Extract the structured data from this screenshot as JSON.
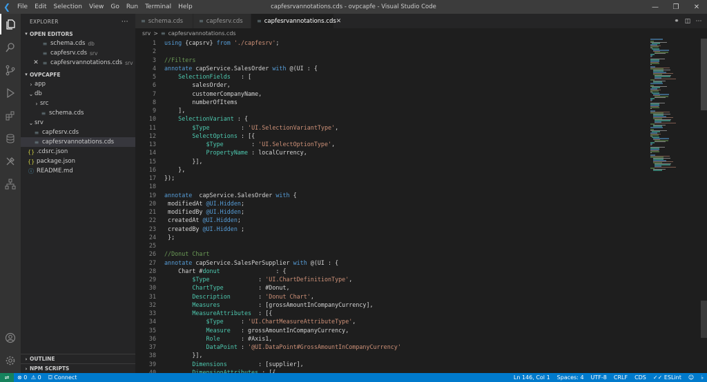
{
  "titlebar": {
    "menu": [
      "File",
      "Edit",
      "Selection",
      "View",
      "Go",
      "Run",
      "Terminal",
      "Help"
    ],
    "title": "capfesrvannotations.cds - ovpcapfe - Visual Studio Code"
  },
  "sidebar": {
    "header": "EXPLORER",
    "open_editors_label": "OPEN EDITORS",
    "open_editors": [
      {
        "name": "schema.cds",
        "dir": "db"
      },
      {
        "name": "capfesrv.cds",
        "dir": "srv"
      },
      {
        "name": "capfesrvannotations.cds",
        "dir": "srv"
      }
    ],
    "project_label": "OVPCAPFE",
    "tree": {
      "app": "app",
      "db": "db",
      "db_src": "src",
      "db_schema": "schema.cds",
      "srv": "srv",
      "srv_capfesrv": "capfesrv.cds",
      "srv_annotations": "capfesrvannotations.cds",
      "cdsrc": ".cdsrc.json",
      "package": "package.json",
      "readme": "README.md"
    },
    "outline_label": "OUTLINE",
    "npm_label": "NPM SCRIPTS"
  },
  "tabs": [
    {
      "label": "schema.cds"
    },
    {
      "label": "capfesrv.cds"
    },
    {
      "label": "capfesrvannotations.cds"
    }
  ],
  "breadcrumb": {
    "folder": "srv",
    "sep": ">",
    "file": "capfesrvannotations.cds"
  },
  "editor": {
    "colors": {
      "kw": "#569cd6",
      "str": "#ce9178",
      "comment": "#6a9955",
      "prop": "#4ec9b0",
      "text": "#d4d4d4"
    },
    "lines": [
      {
        "n": "1",
        "tokens": [
          [
            "kw",
            "using "
          ],
          [
            "t",
            "{capsrv} "
          ],
          [
            "kw",
            "from "
          ],
          [
            "str",
            "'./capfesrv'"
          ],
          [
            "t",
            ";"
          ]
        ]
      },
      {
        "n": "2",
        "tokens": []
      },
      {
        "n": "3",
        "tokens": [
          [
            "c",
            "//Filters"
          ]
        ]
      },
      {
        "n": "4",
        "tokens": [
          [
            "kw",
            "annotate "
          ],
          [
            "t",
            "capService.SalesOrder "
          ],
          [
            "kw",
            "with "
          ],
          [
            "t",
            "@(UI : {"
          ]
        ]
      },
      {
        "n": "5",
        "tokens": [
          [
            "t",
            "    "
          ],
          [
            "p",
            "SelectionFields "
          ],
          [
            "t",
            "  : ["
          ]
        ]
      },
      {
        "n": "6",
        "tokens": [
          [
            "t",
            "        salesOrder,"
          ]
        ]
      },
      {
        "n": "7",
        "tokens": [
          [
            "t",
            "        customerCompanyName,"
          ]
        ]
      },
      {
        "n": "8",
        "tokens": [
          [
            "t",
            "        numberOfItems"
          ]
        ]
      },
      {
        "n": "9",
        "tokens": [
          [
            "t",
            "    ],"
          ]
        ]
      },
      {
        "n": "10",
        "tokens": [
          [
            "t",
            "    "
          ],
          [
            "p",
            "SelectionVariant "
          ],
          [
            "t",
            ": {"
          ]
        ]
      },
      {
        "n": "11",
        "tokens": [
          [
            "t",
            "        "
          ],
          [
            "p",
            "$Type         "
          ],
          [
            "t",
            ": "
          ],
          [
            "str",
            "'UI.SelectionVariantType'"
          ],
          [
            "t",
            ","
          ]
        ]
      },
      {
        "n": "12",
        "tokens": [
          [
            "t",
            "        "
          ],
          [
            "p",
            "SelectOptions "
          ],
          [
            "t",
            ": [{"
          ]
        ]
      },
      {
        "n": "13",
        "tokens": [
          [
            "t",
            "            "
          ],
          [
            "p",
            "$Type        "
          ],
          [
            "t",
            ": "
          ],
          [
            "str",
            "'UI.SelectOptionType'"
          ],
          [
            "t",
            ","
          ]
        ]
      },
      {
        "n": "14",
        "tokens": [
          [
            "t",
            "            "
          ],
          [
            "p",
            "PropertyName "
          ],
          [
            "t",
            ": localCurrency,"
          ]
        ]
      },
      {
        "n": "15",
        "tokens": [
          [
            "t",
            "        }],"
          ]
        ]
      },
      {
        "n": "16",
        "tokens": [
          [
            "t",
            "    },"
          ]
        ]
      },
      {
        "n": "17",
        "tokens": [
          [
            "t",
            "});"
          ]
        ]
      },
      {
        "n": "18",
        "tokens": []
      },
      {
        "n": "19",
        "tokens": [
          [
            "kw",
            "annotate "
          ],
          [
            "t",
            " capService.SalesOrder "
          ],
          [
            "kw",
            "with "
          ],
          [
            "t",
            "{"
          ]
        ]
      },
      {
        "n": "20",
        "tokens": [
          [
            "t",
            " modifiedAt "
          ],
          [
            "kw",
            "@UI.Hidden"
          ],
          [
            "t",
            ";"
          ]
        ]
      },
      {
        "n": "21",
        "tokens": [
          [
            "t",
            " modifiedBy "
          ],
          [
            "kw",
            "@UI.Hidden"
          ],
          [
            "t",
            ";"
          ]
        ]
      },
      {
        "n": "22",
        "tokens": [
          [
            "t",
            " createdAt "
          ],
          [
            "kw",
            "@UI.Hidden"
          ],
          [
            "t",
            ";"
          ]
        ]
      },
      {
        "n": "23",
        "tokens": [
          [
            "t",
            " createdBy "
          ],
          [
            "kw",
            "@UI.Hidden "
          ],
          [
            "t",
            ";"
          ]
        ]
      },
      {
        "n": "24",
        "tokens": [
          [
            "t",
            " };"
          ]
        ]
      },
      {
        "n": "25",
        "tokens": []
      },
      {
        "n": "26",
        "tokens": [
          [
            "c",
            "//Donut Chart"
          ]
        ]
      },
      {
        "n": "27",
        "tokens": [
          [
            "kw",
            "annotate "
          ],
          [
            "t",
            "capService.SalesPerSupplier "
          ],
          [
            "kw",
            "with "
          ],
          [
            "t",
            "@(UI : {"
          ]
        ]
      },
      {
        "n": "28",
        "tokens": [
          [
            "t",
            "    Chart #"
          ],
          [
            "p",
            "donut"
          ],
          [
            "t",
            "                : {"
          ]
        ]
      },
      {
        "n": "29",
        "tokens": [
          [
            "t",
            "        "
          ],
          [
            "p",
            "$Type              "
          ],
          [
            "t",
            ": "
          ],
          [
            "str",
            "'UI.ChartDefinitionType'"
          ],
          [
            "t",
            ","
          ]
        ]
      },
      {
        "n": "30",
        "tokens": [
          [
            "t",
            "        "
          ],
          [
            "p",
            "ChartType          "
          ],
          [
            "t",
            ": #Donut,"
          ]
        ]
      },
      {
        "n": "31",
        "tokens": [
          [
            "t",
            "        "
          ],
          [
            "p",
            "Description        "
          ],
          [
            "t",
            ": "
          ],
          [
            "str",
            "'Donut Chart'"
          ],
          [
            "t",
            ","
          ]
        ]
      },
      {
        "n": "32",
        "tokens": [
          [
            "t",
            "        "
          ],
          [
            "p",
            "Measures           "
          ],
          [
            "t",
            ": [grossAmountInCompanyCurrency],"
          ]
        ]
      },
      {
        "n": "33",
        "tokens": [
          [
            "t",
            "        "
          ],
          [
            "p",
            "MeasureAttributes  "
          ],
          [
            "t",
            ": [{"
          ]
        ]
      },
      {
        "n": "34",
        "tokens": [
          [
            "t",
            "            "
          ],
          [
            "p",
            "$Type     "
          ],
          [
            "t",
            ": "
          ],
          [
            "str",
            "'UI.ChartMeasureAttributeType'"
          ],
          [
            "t",
            ","
          ]
        ]
      },
      {
        "n": "35",
        "tokens": [
          [
            "t",
            "            "
          ],
          [
            "p",
            "Measure   "
          ],
          [
            "t",
            ": grossAmountInCompanyCurrency,"
          ]
        ]
      },
      {
        "n": "36",
        "tokens": [
          [
            "t",
            "            "
          ],
          [
            "p",
            "Role      "
          ],
          [
            "t",
            ": #Axis1,"
          ]
        ]
      },
      {
        "n": "37",
        "tokens": [
          [
            "t",
            "            "
          ],
          [
            "p",
            "DataPoint "
          ],
          [
            "t",
            ": "
          ],
          [
            "str",
            "'@UI.DataPoint#GrossAmountInCompanyCurrency'"
          ]
        ]
      },
      {
        "n": "38",
        "tokens": [
          [
            "t",
            "        }],"
          ]
        ]
      },
      {
        "n": "39",
        "tokens": [
          [
            "t",
            "        "
          ],
          [
            "p",
            "Dimensions         "
          ],
          [
            "t",
            ": [supplier],"
          ]
        ]
      },
      {
        "n": "40",
        "tokens": [
          [
            "t",
            "        "
          ],
          [
            "p",
            "DimensionAttributes "
          ],
          [
            "t",
            ": [{"
          ]
        ]
      }
    ]
  },
  "statusbar": {
    "remote_icon": "remote-icon",
    "errors": "0",
    "warnings": "0",
    "connect": "Connect",
    "position": "Ln 146, Col 1",
    "spaces": "Spaces: 4",
    "encoding": "UTF-8",
    "eol": "CRLF",
    "language": "CDS",
    "eslint": "ESLint"
  }
}
